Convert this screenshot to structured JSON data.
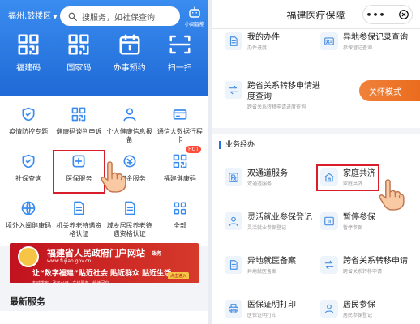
{
  "left": {
    "city": "福州,鼓楼区",
    "search_placeholder": "搜服务，如社保查询",
    "robot_label": "小闽智能",
    "qr": [
      {
        "label": "福建码",
        "icon": "qr-icon"
      },
      {
        "label": "国家码",
        "icon": "qr-icon"
      },
      {
        "label": "办事预约",
        "icon": "calendar-icon"
      },
      {
        "label": "扫一扫",
        "icon": "scan-icon"
      }
    ],
    "services": [
      {
        "label": "疫情防控专题",
        "icon": "shield-icon"
      },
      {
        "label": "健康码谈判申诉",
        "icon": "qr-icon"
      },
      {
        "label": "个人健康信息报备",
        "icon": "person-icon"
      },
      {
        "label": "通信大数据行程卡",
        "icon": "card-icon"
      },
      {
        "label": "社保查询",
        "icon": "shield-icon"
      },
      {
        "label": "医保服务",
        "icon": "medical-icon"
      },
      {
        "label": "公积金服务",
        "icon": "coin-icon"
      },
      {
        "label": "福建健康码",
        "icon": "qr-icon",
        "badge": "HOT"
      },
      {
        "label": "境外入闽健康码",
        "icon": "globe-icon"
      },
      {
        "label": "机关养老待遇资格认证",
        "icon": "doc-icon"
      },
      {
        "label": "城乡居民养老待遇资格认证",
        "icon": "doc-icon"
      },
      {
        "label": "全部",
        "icon": "grid-icon"
      }
    ],
    "banner": {
      "title": "福建省人民政府门户网站",
      "tag": "政务",
      "url": "www.fujian.gov.cn",
      "slogan": "让“数字福建”贴近社会 贴近群众 贴近生活",
      "sub": "权威发布 · 政务公开 · 在线服务 · 解读回应",
      "chip": "点击进入"
    },
    "latest_title": "最新服务"
  },
  "right": {
    "title": "福建医疗保障",
    "top_items": [
      {
        "title": "我的办件",
        "sub": "办件进度",
        "icon": "doc-icon"
      },
      {
        "title": "异地参保记录查询",
        "sub": "参保登记查询",
        "icon": "id-icon"
      },
      {
        "title": "跨省关系转移申请进度查询",
        "sub": "跨省关系转移申请进度查询",
        "icon": "transfer-icon"
      }
    ],
    "care_mode": "关怀模式",
    "section_title": "业务经办",
    "biz_items": [
      {
        "title": "双通道服务",
        "sub": "双通道服务",
        "icon": "rx-icon"
      },
      {
        "title": "家庭共济",
        "sub": "家庭共济",
        "icon": "home-icon"
      },
      {
        "title": "灵活就业参保登记",
        "sub": "灵活就业参保登记",
        "icon": "person-icon"
      },
      {
        "title": "暂停参保",
        "sub": "暂停参保",
        "icon": "pause-icon"
      },
      {
        "title": "异地就医备案",
        "sub": "异地就医备案",
        "icon": "doc-icon"
      },
      {
        "title": "跨省关系转移申请",
        "sub": "跨省关系转移申请",
        "icon": "transfer-icon"
      },
      {
        "title": "医保证明打印",
        "sub": "医保证明打印",
        "icon": "printer-icon"
      },
      {
        "title": "居民参保",
        "sub": "居民参保登记",
        "icon": "person-icon"
      }
    ]
  },
  "colors": {
    "primary": "#1f6ad6",
    "highlight": "#d81e2a",
    "care": "#ea6a1b",
    "banner": "#c1121f"
  }
}
